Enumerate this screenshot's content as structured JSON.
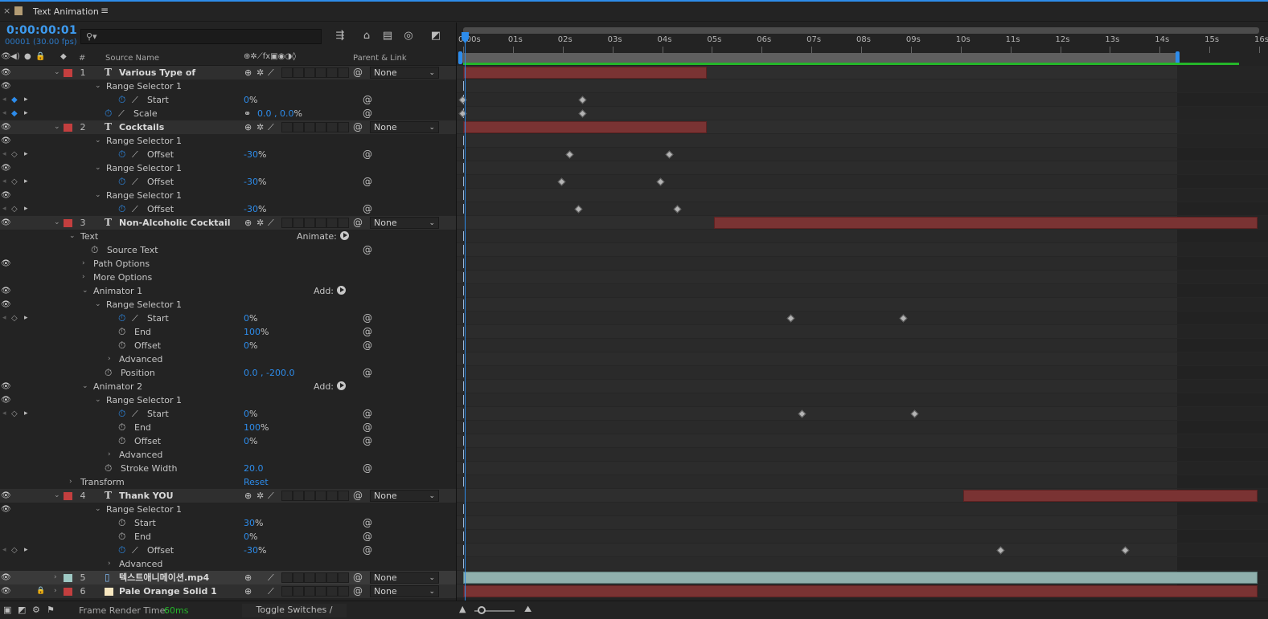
{
  "panel": {
    "close_glyph": "×",
    "title": "Text Animation",
    "menu_glyph": "≡",
    "swatch_color": "#b39c74"
  },
  "controls": {
    "timecode": "0:00:00:01",
    "frame_info": "00001 (30.00 fps)",
    "search_icon": "⚲▾",
    "search_placeholder": ""
  },
  "columns": {
    "number": "#",
    "source_name": "Source Name",
    "parent_link": "Parent & Link"
  },
  "timeline": {
    "seconds_per_ruler": 16,
    "ticks": [
      "0:00s",
      "01s",
      "02s",
      "03s",
      "04s",
      "05s",
      "06s",
      "07s",
      "08s",
      "09s",
      "10s",
      "11s",
      "12s",
      "13s",
      "14s",
      "15s",
      "16s"
    ],
    "work_area_end_seconds": 14.35,
    "current_time_seconds": 0.033
  },
  "rows": [
    {
      "kind": "layer",
      "num": "1",
      "type": "T",
      "name": "Various Type of",
      "label_color": "#c33f3f",
      "parent": "None",
      "bar": [
        0,
        4.9
      ],
      "bar_kind": "red"
    },
    {
      "kind": "group",
      "indent": 2,
      "name": "Range Selector 1"
    },
    {
      "kind": "prop",
      "indent": 3,
      "name": "Start",
      "graph": true,
      "stopwatch_on": true,
      "kf_on": true,
      "value": "0",
      "unit": "%",
      "keys": [
        0,
        2.4
      ]
    },
    {
      "kind": "prop",
      "indent": 2,
      "name": "Scale",
      "graph": true,
      "stopwatch_on": true,
      "kf_on": true,
      "link": true,
      "value": "0.0 , 0.0",
      "unit": "%",
      "keys": [
        0,
        2.4
      ]
    },
    {
      "kind": "layer",
      "num": "2",
      "type": "T",
      "name": "Cocktails",
      "label_color": "#c33f3f",
      "parent": "None",
      "bar": [
        0,
        4.9
      ],
      "bar_kind": "red"
    },
    {
      "kind": "group",
      "indent": 2,
      "name": "Range Selector 1"
    },
    {
      "kind": "prop",
      "indent": 3,
      "name": "Offset",
      "graph": true,
      "stopwatch_on": true,
      "kf_on": false,
      "value": "-30",
      "unit": "%",
      "keys": [
        2.15,
        4.15
      ]
    },
    {
      "kind": "group",
      "indent": 2,
      "name": "Range Selector 1"
    },
    {
      "kind": "prop",
      "indent": 3,
      "name": "Offset",
      "graph": true,
      "stopwatch_on": true,
      "kf_on": false,
      "value": "-30",
      "unit": "%",
      "keys": [
        1.98,
        3.98
      ]
    },
    {
      "kind": "group",
      "indent": 2,
      "name": "Range Selector 1"
    },
    {
      "kind": "prop",
      "indent": 3,
      "name": "Offset",
      "graph": true,
      "stopwatch_on": true,
      "kf_on": false,
      "value": "-30",
      "unit": "%",
      "keys": [
        2.32,
        4.32
      ]
    },
    {
      "kind": "layer",
      "num": "3",
      "type": "T",
      "name": "Non-Alcoholic Cocktail",
      "label_color": "#c33f3f",
      "parent": "None",
      "bar": [
        5.05,
        16
      ],
      "bar_kind": "red"
    },
    {
      "kind": "group",
      "indent": 0,
      "name": "Text",
      "extra": "Animate:"
    },
    {
      "kind": "prop",
      "indent": 1,
      "name": "Source Text",
      "graph": false,
      "stopwatch_on": false,
      "value": "",
      "unit": ""
    },
    {
      "kind": "group",
      "indent": 1,
      "name": "Path Options",
      "collapsed": true
    },
    {
      "kind": "group",
      "indent": 1,
      "name": "More Options",
      "collapsed": true
    },
    {
      "kind": "group",
      "indent": 1,
      "name": "Animator 1",
      "extra": "Add:"
    },
    {
      "kind": "group",
      "indent": 2,
      "name": "Range Selector 1"
    },
    {
      "kind": "prop",
      "indent": 3,
      "name": "Start",
      "graph": true,
      "stopwatch_on": true,
      "kf_on": false,
      "value": "0",
      "unit": "%",
      "keys": [
        6.6,
        8.85
      ]
    },
    {
      "kind": "prop",
      "indent": 3,
      "name": "End",
      "graph": false,
      "stopwatch_on": false,
      "value": "100",
      "unit": "%"
    },
    {
      "kind": "prop",
      "indent": 3,
      "name": "Offset",
      "graph": false,
      "stopwatch_on": false,
      "value": "0",
      "unit": "%"
    },
    {
      "kind": "group",
      "indent": 3,
      "name": "Advanced",
      "collapsed": true
    },
    {
      "kind": "prop",
      "indent": 2,
      "name": "Position",
      "graph": false,
      "stopwatch_on": false,
      "value": "0.0 , -200.0",
      "unit": ""
    },
    {
      "kind": "group",
      "indent": 1,
      "name": "Animator 2",
      "extra": "Add:"
    },
    {
      "kind": "group",
      "indent": 2,
      "name": "Range Selector 1"
    },
    {
      "kind": "prop",
      "indent": 3,
      "name": "Start",
      "graph": true,
      "stopwatch_on": true,
      "kf_on": false,
      "value": "0",
      "unit": "%",
      "keys": [
        6.82,
        9.08
      ]
    },
    {
      "kind": "prop",
      "indent": 3,
      "name": "End",
      "graph": false,
      "stopwatch_on": false,
      "value": "100",
      "unit": "%"
    },
    {
      "kind": "prop",
      "indent": 3,
      "name": "Offset",
      "graph": false,
      "stopwatch_on": false,
      "value": "0",
      "unit": "%"
    },
    {
      "kind": "group",
      "indent": 3,
      "name": "Advanced",
      "collapsed": true
    },
    {
      "kind": "prop",
      "indent": 2,
      "name": "Stroke Width",
      "graph": false,
      "stopwatch_on": false,
      "value": "20.0",
      "unit": ""
    },
    {
      "kind": "group",
      "indent": 0,
      "name": "Transform",
      "collapsed": true,
      "extra_blue": "Reset"
    },
    {
      "kind": "layer",
      "num": "4",
      "type": "T",
      "name": "Thank YOU",
      "label_color": "#c33f3f",
      "parent": "None",
      "bar": [
        10.05,
        16
      ],
      "bar_kind": "red"
    },
    {
      "kind": "group",
      "indent": 2,
      "name": "Range Selector 1"
    },
    {
      "kind": "prop",
      "indent": 3,
      "name": "Start",
      "graph": false,
      "stopwatch_on": false,
      "value": "30",
      "unit": "%"
    },
    {
      "kind": "prop",
      "indent": 3,
      "name": "End",
      "graph": false,
      "stopwatch_on": false,
      "value": "0",
      "unit": "%"
    },
    {
      "kind": "prop",
      "indent": 3,
      "name": "Offset",
      "graph": true,
      "stopwatch_on": true,
      "kf_on": false,
      "value": "-30",
      "unit": "%",
      "keys": [
        10.82,
        13.32
      ]
    },
    {
      "kind": "group",
      "indent": 3,
      "name": "Advanced",
      "collapsed": true
    },
    {
      "kind": "layer",
      "num": "5",
      "type": "footage",
      "name": "텍스트애니메이션.mp4",
      "label_color": "#9ec9c4",
      "parent": "None",
      "bar": [
        0,
        16
      ],
      "bar_kind": "footage",
      "selected": true,
      "collapsed": true
    },
    {
      "kind": "layer",
      "num": "6",
      "type": "solid",
      "name": "Pale Orange Solid 1",
      "label_color": "#c33f3f",
      "parent": "None",
      "bar": [
        0,
        16
      ],
      "bar_kind": "red",
      "locked": true,
      "collapsed": true
    }
  ],
  "status": {
    "render_label": "Frame Render Time:",
    "render_value": "60ms",
    "toggle_label": "Toggle Switches / Modes"
  }
}
